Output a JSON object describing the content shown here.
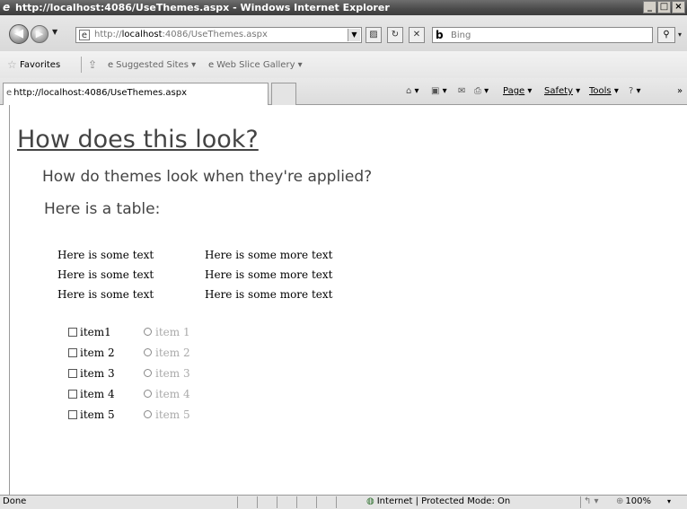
{
  "window": {
    "title": "http://localhost:4086/UseThemes.aspx - Windows Internet Explorer",
    "minimize": "_",
    "maximize": "□",
    "close": "×"
  },
  "address_bar": {
    "url_prefix": "http://",
    "url_host": "localhost",
    "url_rest": ":4086/UseThemes.aspx"
  },
  "search": {
    "placeholder": "Bing"
  },
  "favorites_bar": {
    "favorites_label": "Favorites",
    "items": [
      "Suggested Sites ▾",
      "Web Slice Gallery ▾"
    ]
  },
  "tab": {
    "label": "http://localhost:4086/UseThemes.aspx"
  },
  "command_bar": {
    "page": "Page",
    "safety": "Safety",
    "tools": "Tools"
  },
  "content": {
    "heading": "How does this look?",
    "subheading": "How do themes look when they're applied?",
    "table_heading": "Here is a table:",
    "table_rows": [
      [
        "Here is some text",
        "Here is some more text"
      ],
      [
        "Here is some text",
        "Here is some more text"
      ],
      [
        "Here is some text",
        "Here is some more text"
      ]
    ],
    "checkbox_items": [
      "item1",
      "item 2",
      "item 3",
      "item 4",
      "item 5"
    ],
    "radio_items": [
      "item 1",
      "item 2",
      "item 3",
      "item 4",
      "item 5"
    ]
  },
  "status_bar": {
    "status": "Done",
    "zone": "Internet | Protected Mode: On",
    "zoom": "100%"
  }
}
